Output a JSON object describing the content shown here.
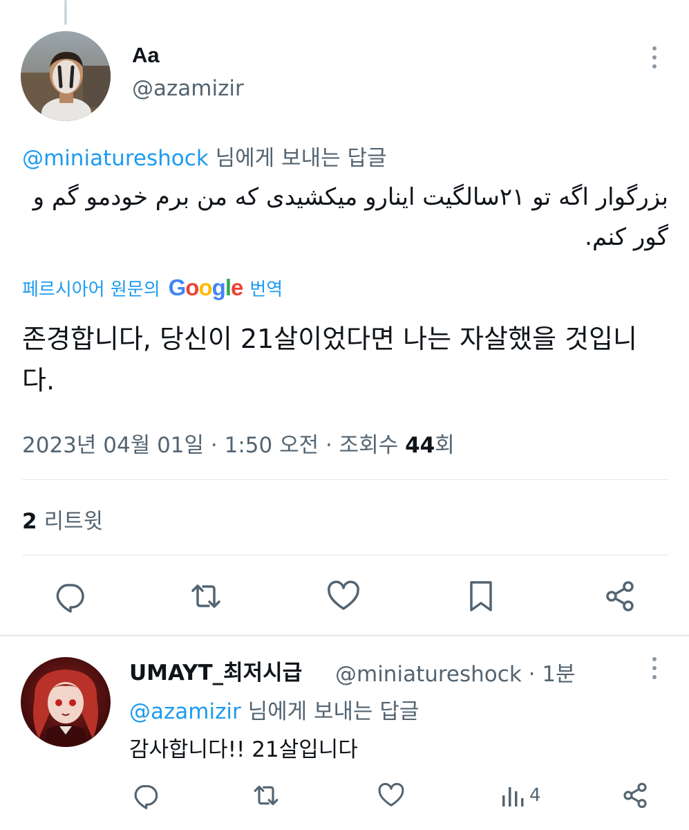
{
  "tweet": {
    "author_name": "Aa",
    "author_handle": "@azamizir",
    "reply_to_mention": "@miniatureshock",
    "reply_to_suffix": " 님에게 보내는 답글",
    "original_text": "بزرگوار اگه تو ۲۱سالگیت اینارو میکشیدی که من برم خودمو گم و گور کنم.",
    "translation_prefix": "페르시아어 원문의",
    "translation_suffix": "번역",
    "translation_brand": "Google",
    "translated_text": "존경합니다, 당신이 21살이었다면 나는 자살했을 것입니다.",
    "timestamp": "2023년 04월 01일 · 1:50 오전 · 조회수 ",
    "views_count": "44",
    "views_suffix": "회",
    "retweet_count": "2",
    "retweet_label": "리트윗"
  },
  "reply": {
    "author_name": "UMAYT_최저시급",
    "author_handle_time": "@miniatureshock · 1분",
    "reply_to_mention": "@azamizir",
    "reply_to_suffix": " 님에게 보내는 답글",
    "text": "감사합니다!! 21살입니다",
    "views_count": "4"
  },
  "colors": {
    "accent": "#1d9bf0",
    "secondary_text": "#536471",
    "primary_text": "#0f1419",
    "divider": "#e1e8ed"
  },
  "icons": {
    "more": "more-icon",
    "reply": "reply-icon",
    "retweet": "retweet-icon",
    "like": "heart-icon",
    "bookmark": "bookmark-icon",
    "share": "share-icon",
    "views": "views-icon"
  }
}
